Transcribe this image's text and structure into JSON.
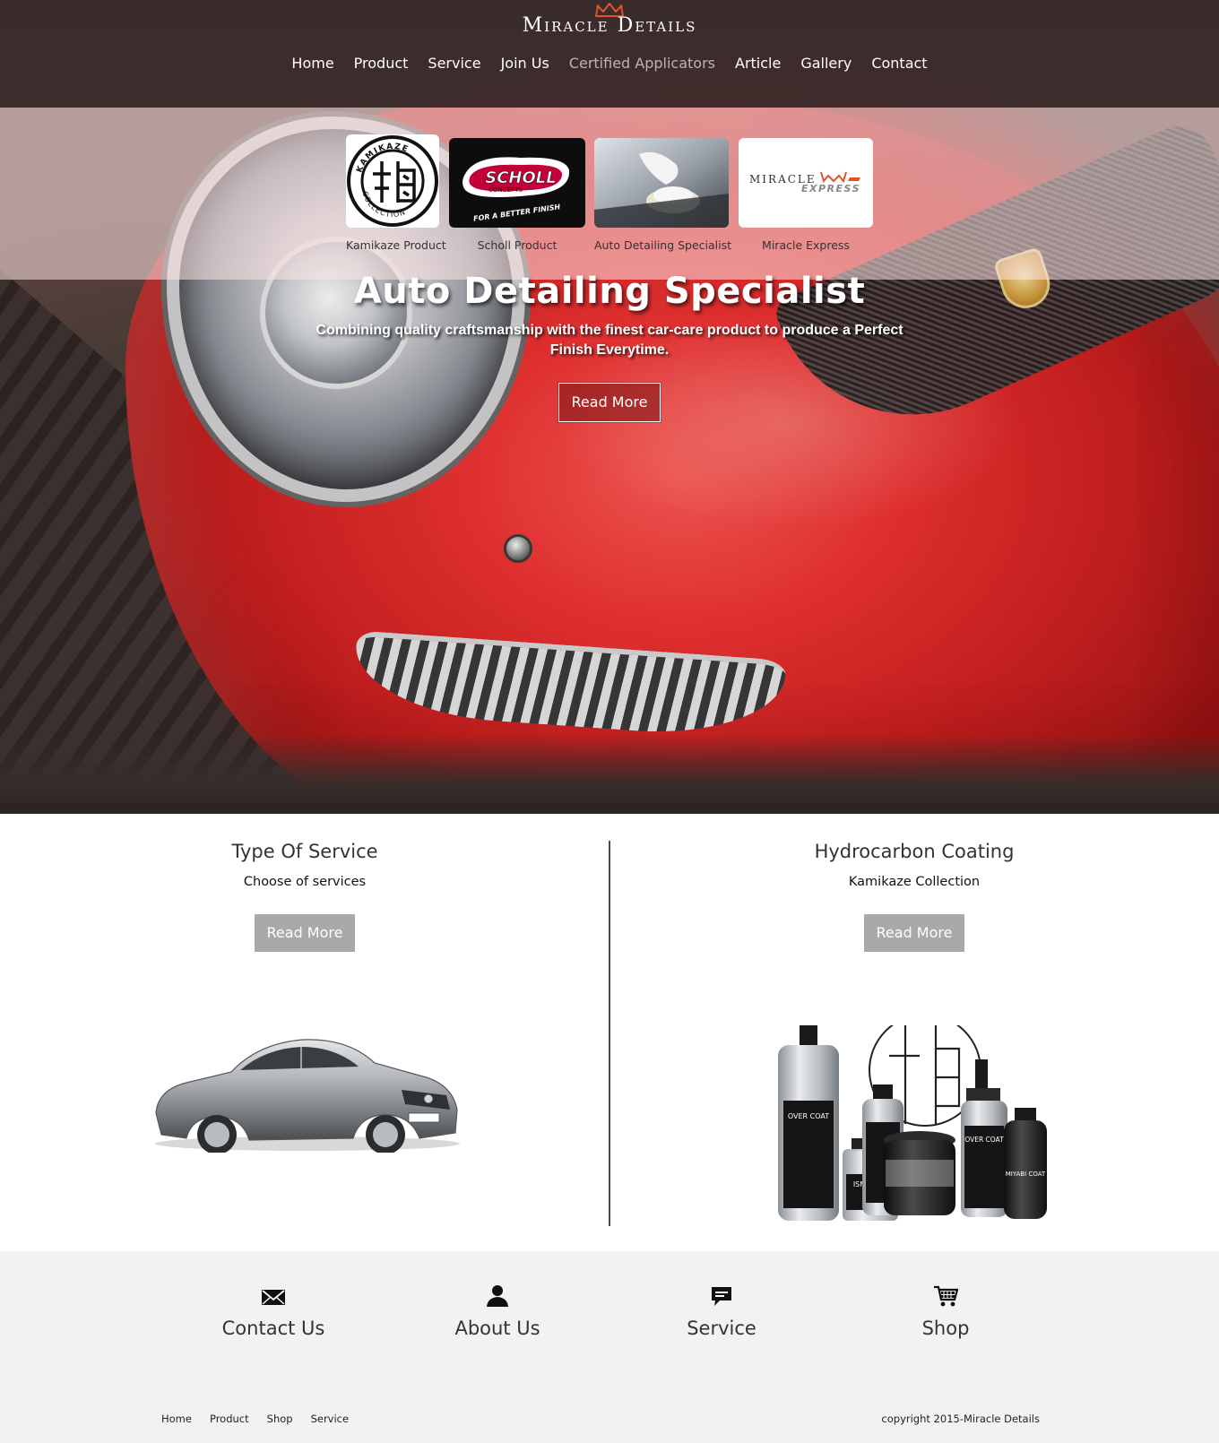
{
  "header": {
    "logo_text": "Miracle Details",
    "nav": [
      {
        "label": "Home"
      },
      {
        "label": "Product"
      },
      {
        "label": "Service"
      },
      {
        "label": "Join Us"
      },
      {
        "label": "Certified Applicators"
      },
      {
        "label": "Article"
      },
      {
        "label": "Gallery"
      },
      {
        "label": "Contact"
      }
    ]
  },
  "brands": [
    {
      "label": "Kamikaze Product",
      "logo_text": "KAMIKAZE COLLECTION"
    },
    {
      "label": "Scholl Product",
      "logo_text": "SCHOLL",
      "logo_sub": "CONCEPTS",
      "logo_tag": "FOR A BETTER FINISH"
    },
    {
      "label": "Auto Detailing Specialist"
    },
    {
      "label": "Miracle Express",
      "logo_text": "MIRACLE",
      "logo_sub": "EXPRESS"
    }
  ],
  "hero": {
    "title": "Auto Detailing Specialist",
    "subtitle": "Combining quality craftsmanship with the finest car-care product to produce a Perfect Finish Everytime.",
    "button": "Read More"
  },
  "features": {
    "left": {
      "title": "Type Of Service",
      "subtitle": "Choose of services",
      "button": "Read More"
    },
    "right": {
      "title": "Hydrocarbon Coating",
      "subtitle": "Kamikaze Collection",
      "button": "Read More",
      "bottle_labels": [
        "OVER COAT",
        "ISM COAT",
        "OVER COAT",
        "MIYABI COAT"
      ]
    }
  },
  "footer": {
    "links": [
      {
        "label": "Contact Us",
        "icon": "mail-icon"
      },
      {
        "label": "About Us",
        "icon": "user-icon"
      },
      {
        "label": "Service",
        "icon": "chat-icon"
      },
      {
        "label": "Shop",
        "icon": "cart-icon"
      }
    ],
    "bottom_nav": [
      {
        "label": "Home"
      },
      {
        "label": "Product"
      },
      {
        "label": "Shop"
      },
      {
        "label": "Service"
      }
    ],
    "copyright": "copyright 2015-Miracle Details"
  },
  "colors": {
    "header_bg": "#3a2a2a",
    "accent_red": "#e02a2a",
    "button_gray": "#a9a9a9",
    "footer_bg": "#f2f2f2"
  }
}
